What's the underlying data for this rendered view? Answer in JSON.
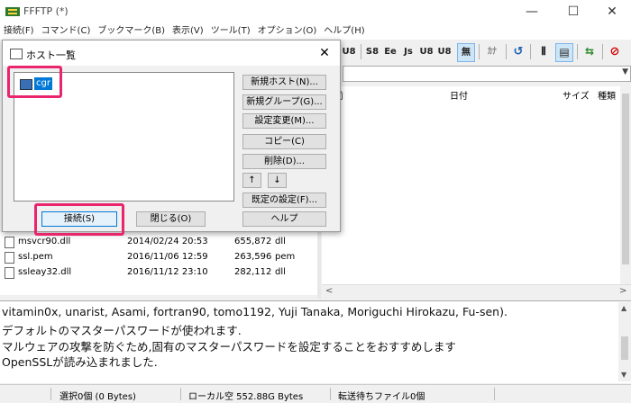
{
  "window": {
    "title": "FFFTP (*)",
    "controls": {
      "minimize": "—",
      "maximize": "☐",
      "close": "✕"
    }
  },
  "menu": [
    "接続(F)",
    "コマンド(C)",
    "ブックマーク(B)",
    "表示(V)",
    "ツール(T)",
    "オプション(O)",
    "ヘルプ(H)"
  ],
  "toolbar": {
    "buttons": [
      {
        "label": "U8"
      },
      {
        "label": "S8"
      },
      {
        "label": "Ee"
      },
      {
        "label": "Js"
      },
      {
        "label": "U8"
      },
      {
        "label": "U8"
      },
      {
        "label": "無"
      },
      {
        "label": "ｶﾅ"
      },
      {
        "label": "↺"
      },
      {
        "label": "⦀"
      },
      {
        "label": "▤"
      },
      {
        "label": "⇆"
      },
      {
        "label": "⊘"
      }
    ],
    "colors": {
      "selected_bg": "#cde6f7",
      "selected_border": "#7eb4ea"
    }
  },
  "remote": {
    "columns": {
      "name": "前",
      "date": "日付",
      "size": "サイズ",
      "type": "種類"
    },
    "folder_icon": "folder-open-icon"
  },
  "local_files": [
    {
      "name": "msvcr90.dll",
      "date": "2014/02/24 20:53",
      "size": "655,872",
      "type": "dll"
    },
    {
      "name": "ssl.pem",
      "date": "2016/11/06 12:59",
      "size": "263,596",
      "type": "pem"
    },
    {
      "name": "ssleay32.dll",
      "date": "2016/11/12 23:10",
      "size": "282,112",
      "type": "dll"
    }
  ],
  "log": [
    "vitamin0x, unarist, Asami, fortran90, tomo1192, Yuji Tanaka, Moriguchi Hirokazu, Fu-sen).",
    "デフォルトのマスターパスワードが使われます.",
    "マルウェアの攻撃を防ぐため,固有のマスターパスワードを設定することをおすすめします",
    "OpenSSLが読み込まれました."
  ],
  "status": {
    "selection": "選択0個 (0 Bytes)",
    "local_free": "ローカル空 552.88G Bytes",
    "transfer_queue": "転送待ちファイル0個"
  },
  "dialog": {
    "title": "ホスト一覧",
    "close": "✕",
    "host_item": "cgr",
    "buttons": {
      "new_host": "新規ホスト(N)...",
      "new_group": "新規グループ(G)...",
      "modify": "設定変更(M)...",
      "copy": "コピー(C)",
      "delete": "削除(D)...",
      "up": "↑",
      "down": "↓",
      "default": "既定の設定(F)...",
      "help": "ヘルプ",
      "connect": "接続(S)",
      "close": "閉じる(O)"
    },
    "highlight_color": "#e8256d"
  }
}
